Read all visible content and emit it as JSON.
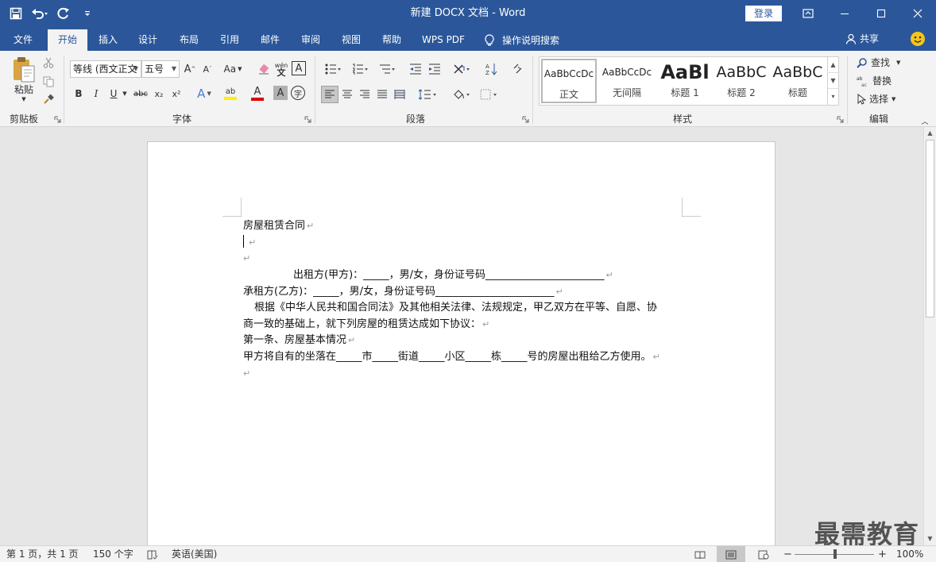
{
  "window": {
    "title": "新建 DOCX 文档  -  Word",
    "login_label": "登录"
  },
  "tabs": [
    "文件",
    "开始",
    "插入",
    "设计",
    "布局",
    "引用",
    "邮件",
    "审阅",
    "视图",
    "帮助",
    "WPS PDF",
    "操作说明搜索"
  ],
  "active_tab": "开始",
  "share_label": "共享",
  "ribbon": {
    "clipboard": {
      "label": "剪贴板",
      "paste_label": "粘贴"
    },
    "font": {
      "label": "字体",
      "font_name": "等线 (西文正文",
      "font_size": "五号",
      "grow": "A",
      "shrink": "A",
      "change_case": "Aa",
      "phonetic": "wén",
      "border_char": "A",
      "bold": "B",
      "italic": "I",
      "underline": "U",
      "strike": "abc",
      "subscript": "x₂",
      "superscript": "x²",
      "text_effect": "A",
      "highlight": "ab",
      "font_color": "A",
      "shading_char": "A",
      "enclosed": "字"
    },
    "paragraph": {
      "label": "段落"
    },
    "styles": {
      "label": "样式",
      "items": [
        {
          "preview": "AaBbCcDc",
          "name": "正文"
        },
        {
          "preview": "AaBbCcDc",
          "name": "无间隔"
        },
        {
          "preview": "AaBl",
          "name": "标题 1"
        },
        {
          "preview": "AaBbC",
          "name": "标题 2"
        },
        {
          "preview": "AaBbC",
          "name": "标题"
        }
      ]
    },
    "editing": {
      "label": "编辑",
      "find": "查找",
      "replace": "替换",
      "select": "选择"
    }
  },
  "document": {
    "lines": [
      "房屋租赁合同",
      "",
      "",
      "出租方(甲方)：_____，男/女，身份证号码_______________________",
      "承租方(乙方)：_____，男/女，身份证号码_______________________",
      "根据《中华人民共和国合同法》及其他相关法律、法规规定，甲乙双方在平等、自愿、协",
      "商一致的基础上，就下列房屋的租赁达成如下协议：",
      "第一条、房屋基本情况",
      "甲方将自有的坐落在_____市_____街道_____小区_____栋_____号的房屋出租给乙方使用。",
      ""
    ],
    "paragraph_mark": "↵"
  },
  "watermark": "最需教育",
  "status": {
    "page": "第 1 页，共 1 页",
    "words": "150 个字",
    "language": "英语(美国)",
    "zoom": "100%",
    "zoom_minus": "−",
    "zoom_plus": "+"
  },
  "colors": {
    "brand": "#2b579a",
    "ribbon_bg": "#f3f3f3",
    "canvas_bg": "#e6e6e6",
    "font_red": "#e00000",
    "highlight_yellow": "#ffef00"
  }
}
